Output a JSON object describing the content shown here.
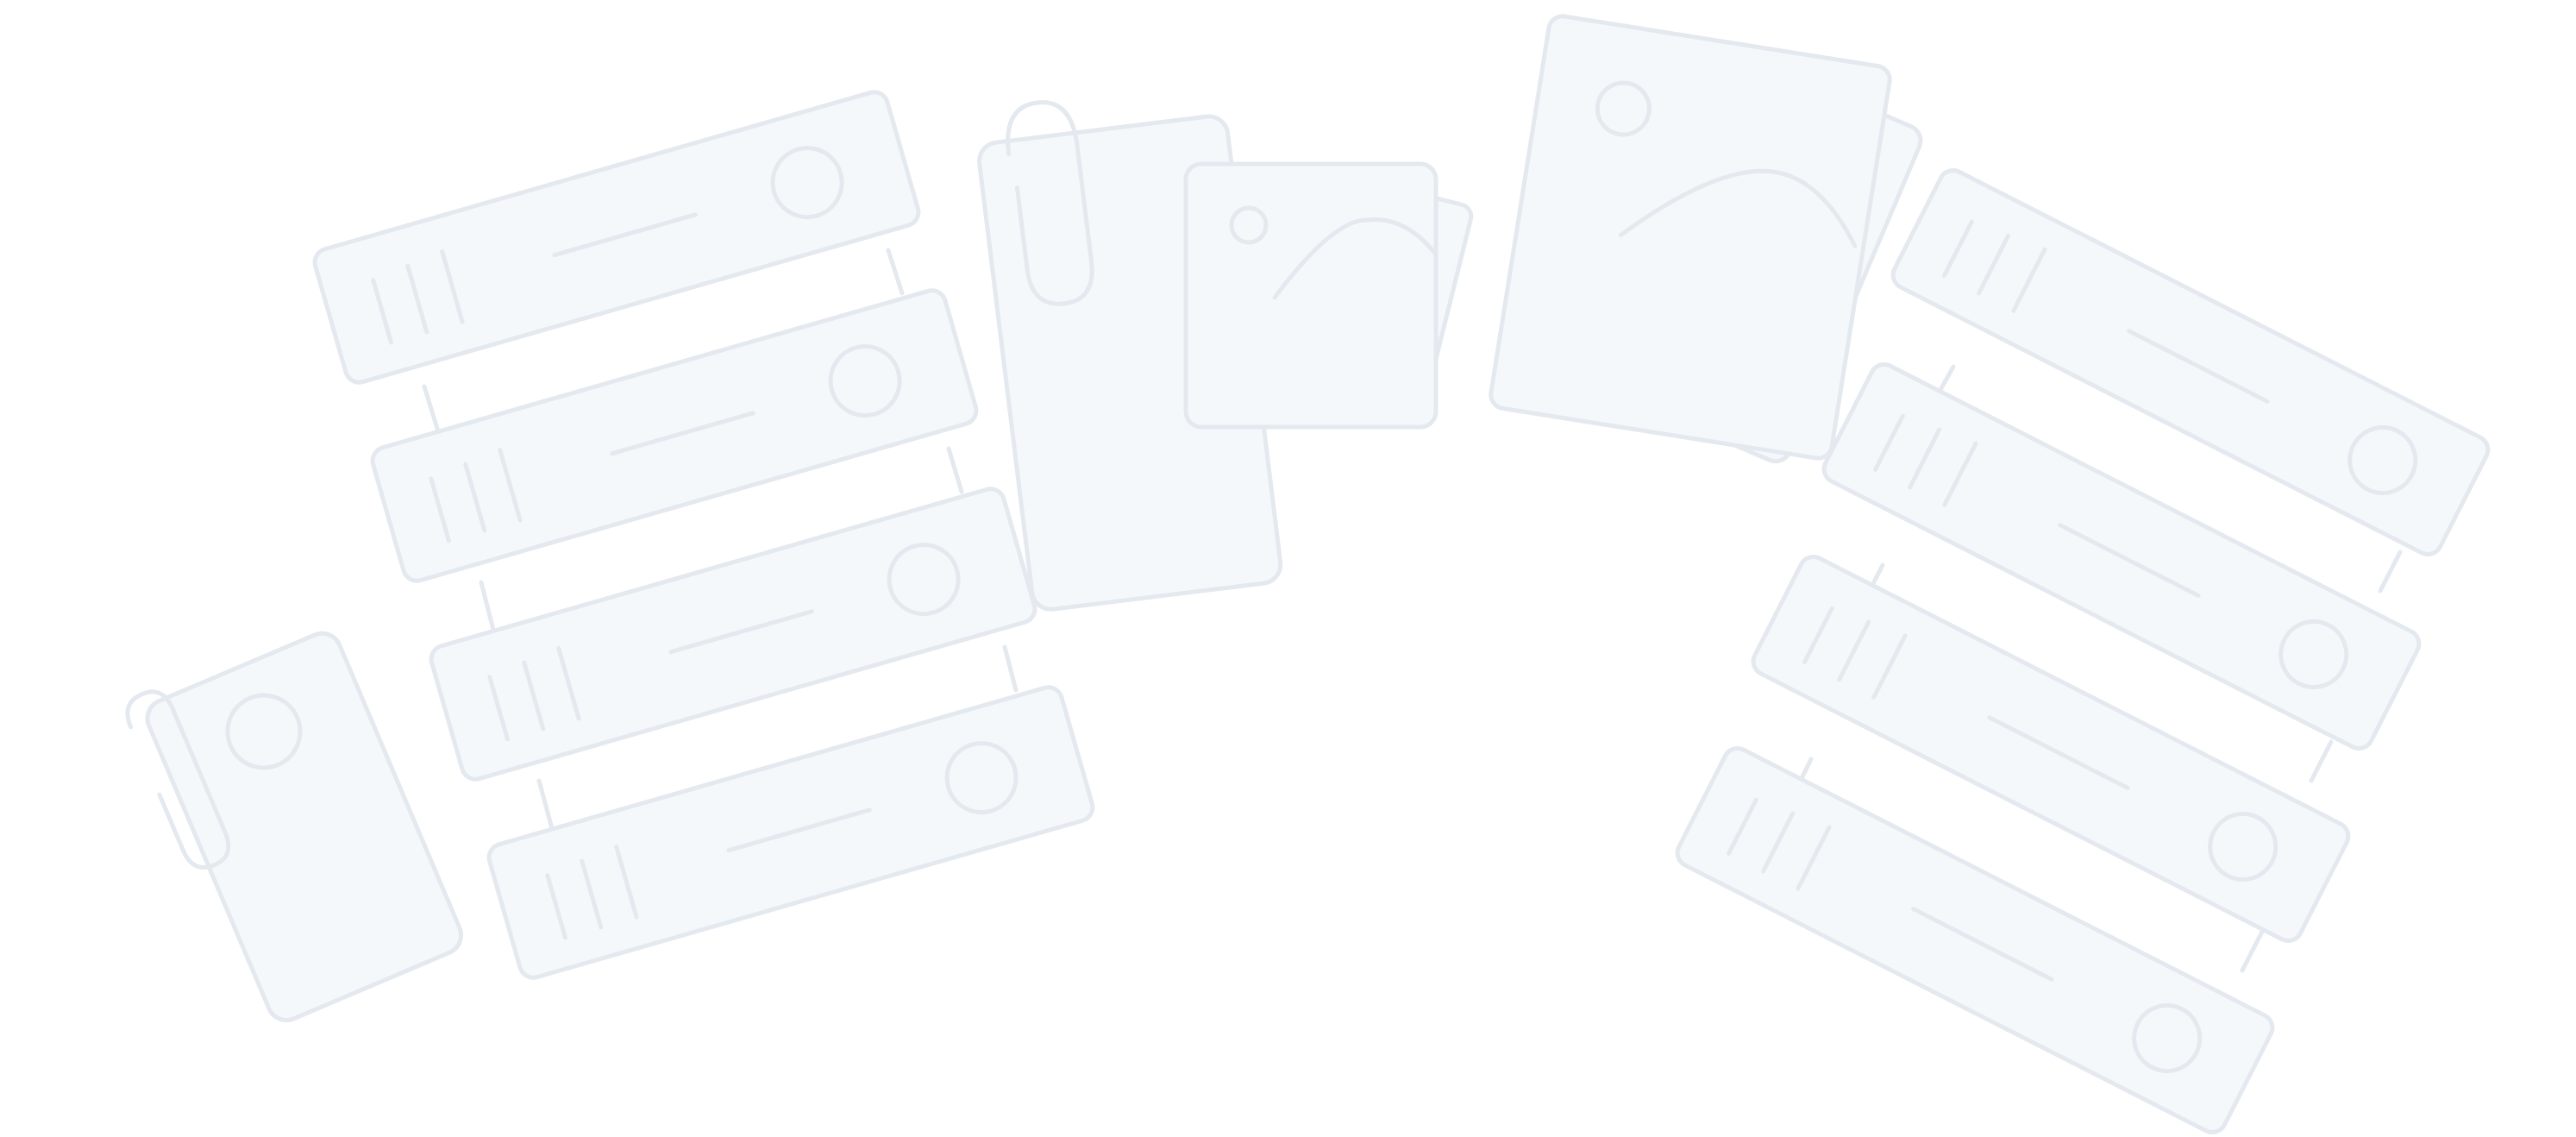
{
  "colors": {
    "fill": "#f5f8fb",
    "stroke": "#e3e9ef",
    "background": "#ffffff"
  },
  "icons": {
    "illustration": "empty-state-illustration",
    "left_group": "stacked-list-cards",
    "center_group": "paperclipped-photo-documents",
    "right_group": "rotated-stacked-list-cards",
    "image_card": "image-placeholder-icon"
  }
}
